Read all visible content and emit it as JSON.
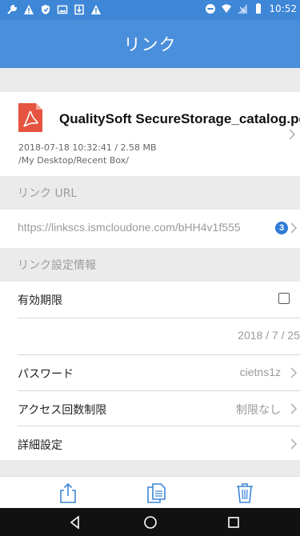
{
  "status_bar": {
    "time": "10:52",
    "left_icons": [
      "wrench-icon",
      "warning-icon",
      "shield-icon",
      "image-icon",
      "download-icon",
      "warning-icon"
    ],
    "right_icons": [
      "dnd-icon",
      "wifi-icon",
      "no-signal-icon",
      "battery-icon"
    ]
  },
  "header": {
    "title": "リンク"
  },
  "file": {
    "icon": "pdf-icon",
    "name": "QualitySoft SecureStorage_catalog.pdf",
    "date_size": "2018-07-18 10:32:41  /  2.58 MB",
    "path": "/My Desktop/Recent Box/"
  },
  "link_url": {
    "header": "リンク URL",
    "url": "https://linkscs.ismcloudone.com/bHH4v1f555",
    "badge": "3"
  },
  "settings": {
    "header": "リンク設定情報",
    "expiry_label": "有効期限",
    "expiry_checked": false,
    "expiry_date": "2018 / 7 / 25",
    "password_label": "パスワード",
    "password_value": "cietns1z",
    "access_label": "アクセス回数制限",
    "access_value": "制限なし",
    "detail_label": "詳細設定"
  },
  "toolbar": {
    "items": [
      "share-icon",
      "copy-icon",
      "trash-icon"
    ]
  },
  "navbar": {
    "items": [
      "back-icon",
      "home-icon",
      "recents-icon"
    ]
  },
  "colors": {
    "accent": "#4a8fdc",
    "status_bar": "#3e86d6",
    "badge": "#2f7bd6",
    "pdf_red": "#e5543f"
  }
}
